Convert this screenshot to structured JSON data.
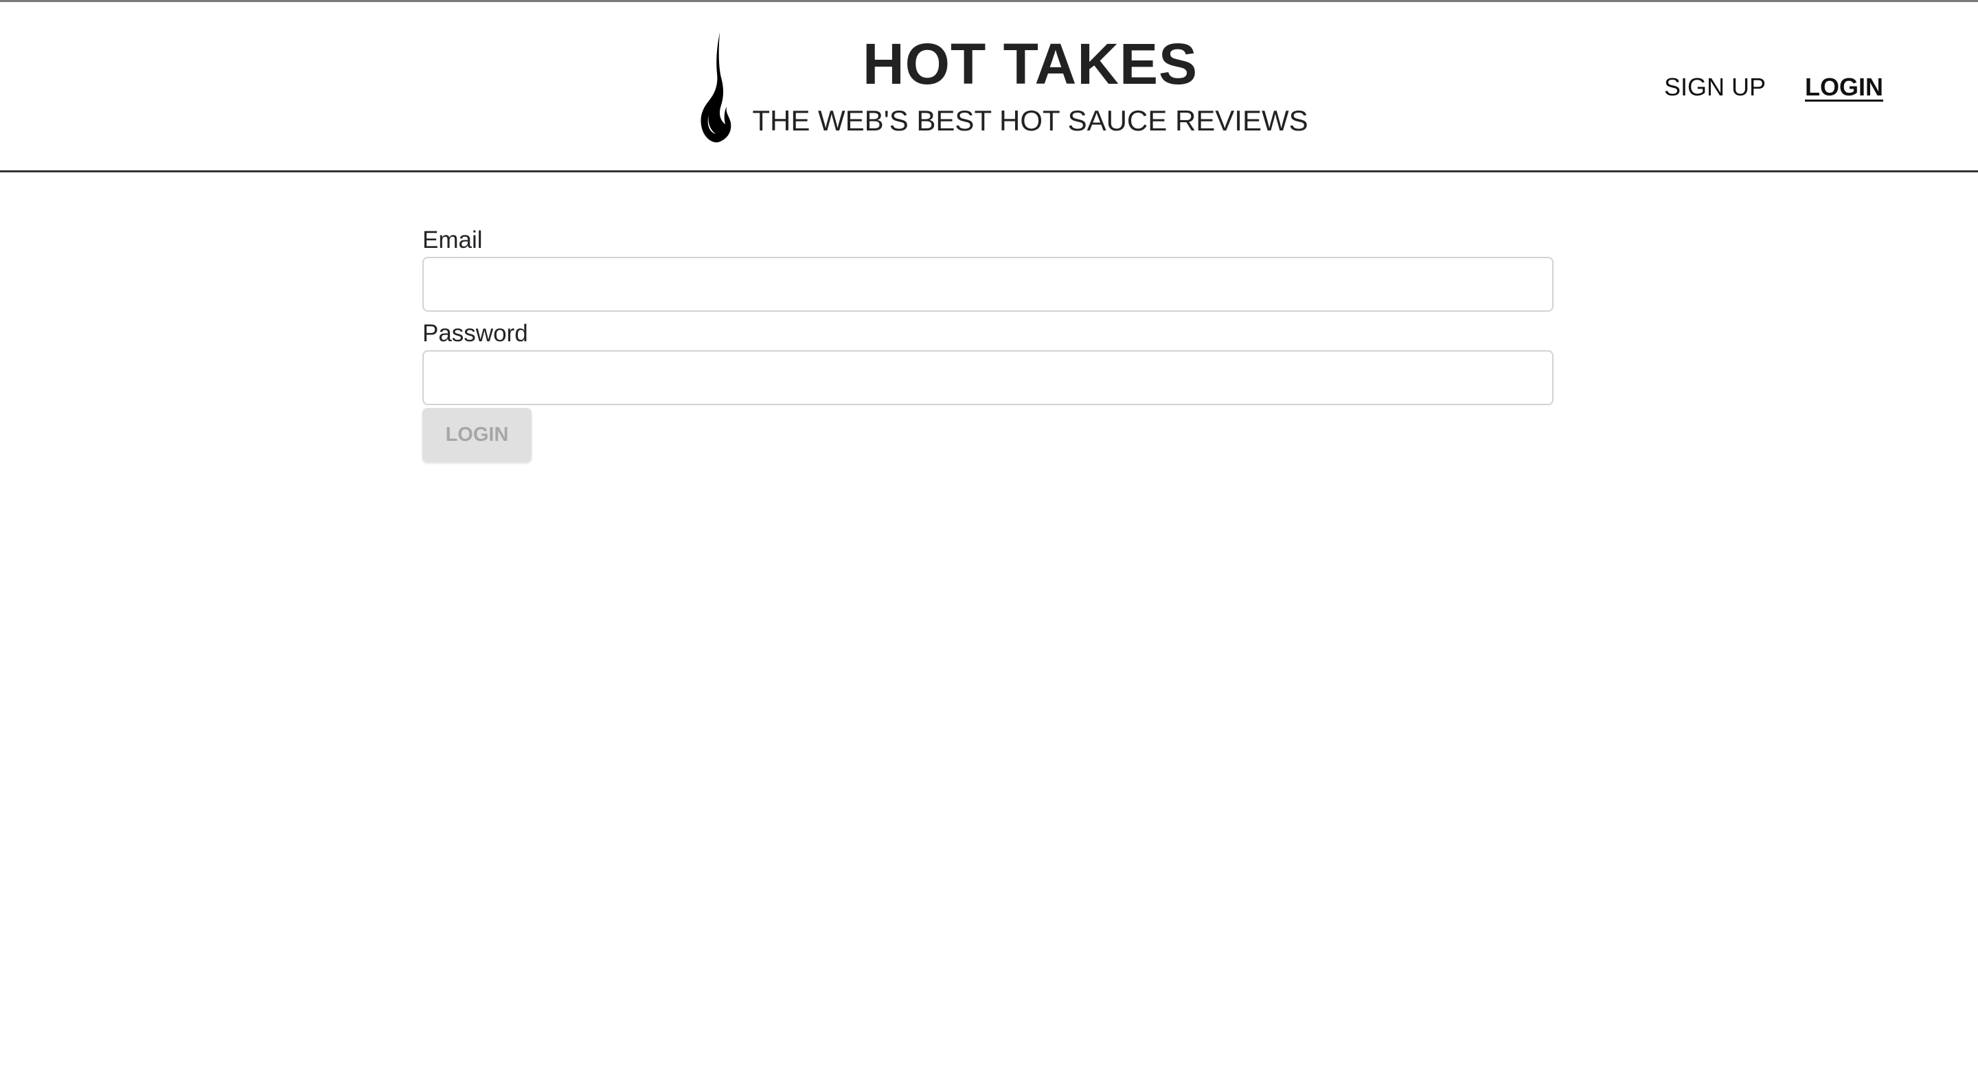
{
  "header": {
    "logo_icon": "flame-icon",
    "title": "HOT TAKES",
    "subtitle": "THE WEB'S BEST HOT SAUCE REVIEWS",
    "nav": {
      "signup": "SIGN UP",
      "login": "LOGIN"
    }
  },
  "form": {
    "email_label": "Email",
    "email_value": "",
    "password_label": "Password",
    "password_value": "",
    "submit_label": "LOGIN",
    "submit_disabled": true
  }
}
